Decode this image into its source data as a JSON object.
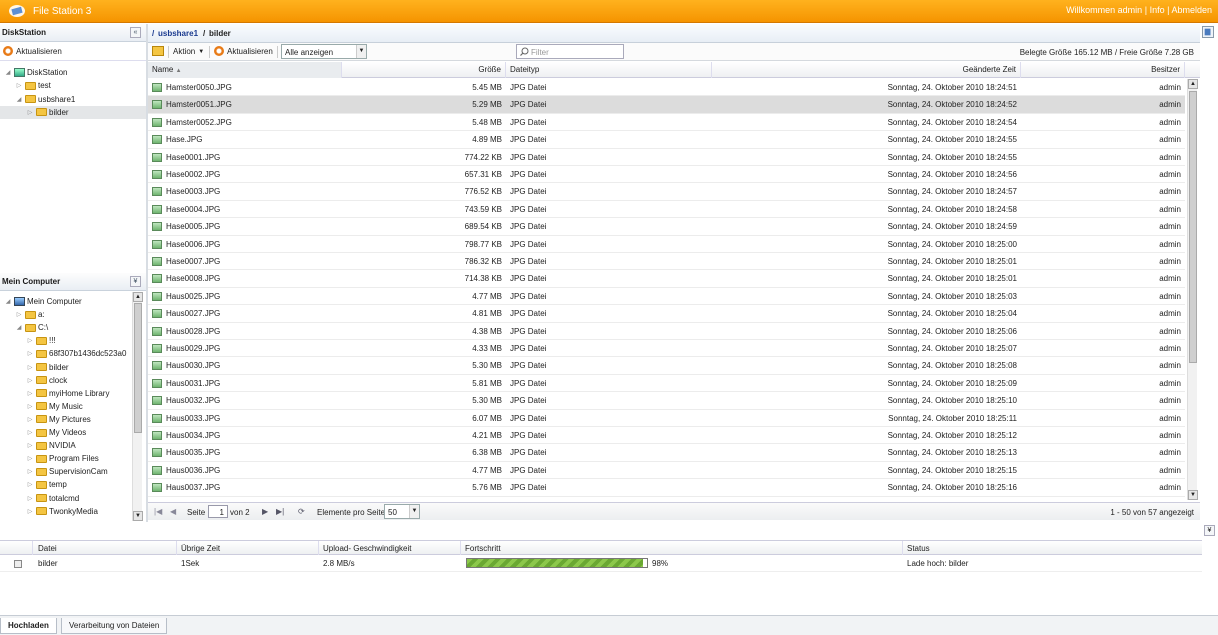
{
  "titlebar": {
    "app_title": "File Station 3",
    "welcome": "Willkommen admin",
    "info": "Info",
    "logout": "Abmelden",
    "sep": "|"
  },
  "diskstation": {
    "title": "DiskStation",
    "refresh": "Aktualisieren",
    "tree": [
      {
        "label": "DiskStation",
        "type": "drive",
        "indent": 0,
        "tri": "◢"
      },
      {
        "label": "test",
        "type": "folder",
        "indent": 1,
        "tri": "▷"
      },
      {
        "label": "usbshare1",
        "type": "folder",
        "indent": 1,
        "tri": "◢"
      },
      {
        "label": "bilder",
        "type": "folder",
        "indent": 2,
        "tri": "▷",
        "selected": true
      }
    ]
  },
  "mycomputer": {
    "title": "Mein Computer",
    "tree": [
      {
        "label": "Mein Computer",
        "type": "pc",
        "indent": 0,
        "tri": "◢"
      },
      {
        "label": "a:",
        "type": "folder",
        "indent": 1,
        "tri": "▷"
      },
      {
        "label": "C:\\",
        "type": "folder",
        "indent": 1,
        "tri": "◢"
      },
      {
        "label": "!!!",
        "type": "folder",
        "indent": 2,
        "tri": "▷"
      },
      {
        "label": "68f307b1436dc523a0",
        "type": "folder",
        "indent": 2,
        "tri": "▷"
      },
      {
        "label": "bilder",
        "type": "folder",
        "indent": 2,
        "tri": "▷"
      },
      {
        "label": "clock",
        "type": "folder",
        "indent": 2,
        "tri": "▷"
      },
      {
        "label": "myiHome Library",
        "type": "folder",
        "indent": 2,
        "tri": "▷"
      },
      {
        "label": "My Music",
        "type": "folder",
        "indent": 2,
        "tri": "▷"
      },
      {
        "label": "My Pictures",
        "type": "folder",
        "indent": 2,
        "tri": "▷"
      },
      {
        "label": "My Videos",
        "type": "folder",
        "indent": 2,
        "tri": "▷"
      },
      {
        "label": "NVIDIA",
        "type": "folder",
        "indent": 2,
        "tri": "▷"
      },
      {
        "label": "Program Files",
        "type": "folder",
        "indent": 2,
        "tri": "▷"
      },
      {
        "label": "SupervisionCam",
        "type": "folder",
        "indent": 2,
        "tri": "▷"
      },
      {
        "label": "temp",
        "type": "folder",
        "indent": 2,
        "tri": "▷"
      },
      {
        "label": "totalcmd",
        "type": "folder",
        "indent": 2,
        "tri": "▷"
      },
      {
        "label": "TwonkyMedia",
        "type": "folder",
        "indent": 2,
        "tri": "▷"
      }
    ]
  },
  "path": {
    "root": "/",
    "share": "usbshare1",
    "sep": "/",
    "folder": "bilder"
  },
  "toolbar": {
    "action": "Aktion",
    "refresh": "Aktualisieren",
    "view_select": "Alle anzeigen",
    "filter_placeholder": "Filter",
    "size_info": "Belegte Größe 165.12 MB / Freie Größe 7.28 GB"
  },
  "columns": {
    "name": "Name",
    "size": "Größe",
    "type": "Dateityp",
    "modified": "Geänderte Zeit",
    "owner": "Besitzer"
  },
  "files": [
    {
      "name": "Hamster0050.JPG",
      "size": "5.45 MB",
      "type": "JPG Datei",
      "modified": "Sonntag, 24. Oktober 2010 18:24:51",
      "owner": "admin"
    },
    {
      "name": "Hamster0051.JPG",
      "size": "5.29 MB",
      "type": "JPG Datei",
      "modified": "Sonntag, 24. Oktober 2010 18:24:52",
      "owner": "admin",
      "selected": true
    },
    {
      "name": "Hamster0052.JPG",
      "size": "5.48 MB",
      "type": "JPG Datei",
      "modified": "Sonntag, 24. Oktober 2010 18:24:54",
      "owner": "admin"
    },
    {
      "name": "Hase.JPG",
      "size": "4.89 MB",
      "type": "JPG Datei",
      "modified": "Sonntag, 24. Oktober 2010 18:24:55",
      "owner": "admin"
    },
    {
      "name": "Hase0001.JPG",
      "size": "774.22 KB",
      "type": "JPG Datei",
      "modified": "Sonntag, 24. Oktober 2010 18:24:55",
      "owner": "admin"
    },
    {
      "name": "Hase0002.JPG",
      "size": "657.31 KB",
      "type": "JPG Datei",
      "modified": "Sonntag, 24. Oktober 2010 18:24:56",
      "owner": "admin"
    },
    {
      "name": "Hase0003.JPG",
      "size": "776.52 KB",
      "type": "JPG Datei",
      "modified": "Sonntag, 24. Oktober 2010 18:24:57",
      "owner": "admin"
    },
    {
      "name": "Hase0004.JPG",
      "size": "743.59 KB",
      "type": "JPG Datei",
      "modified": "Sonntag, 24. Oktober 2010 18:24:58",
      "owner": "admin"
    },
    {
      "name": "Hase0005.JPG",
      "size": "689.54 KB",
      "type": "JPG Datei",
      "modified": "Sonntag, 24. Oktober 2010 18:24:59",
      "owner": "admin"
    },
    {
      "name": "Hase0006.JPG",
      "size": "798.77 KB",
      "type": "JPG Datei",
      "modified": "Sonntag, 24. Oktober 2010 18:25:00",
      "owner": "admin"
    },
    {
      "name": "Hase0007.JPG",
      "size": "786.32 KB",
      "type": "JPG Datei",
      "modified": "Sonntag, 24. Oktober 2010 18:25:01",
      "owner": "admin"
    },
    {
      "name": "Hase0008.JPG",
      "size": "714.38 KB",
      "type": "JPG Datei",
      "modified": "Sonntag, 24. Oktober 2010 18:25:01",
      "owner": "admin"
    },
    {
      "name": "Haus0025.JPG",
      "size": "4.77 MB",
      "type": "JPG Datei",
      "modified": "Sonntag, 24. Oktober 2010 18:25:03",
      "owner": "admin"
    },
    {
      "name": "Haus0027.JPG",
      "size": "4.81 MB",
      "type": "JPG Datei",
      "modified": "Sonntag, 24. Oktober 2010 18:25:04",
      "owner": "admin"
    },
    {
      "name": "Haus0028.JPG",
      "size": "4.38 MB",
      "type": "JPG Datei",
      "modified": "Sonntag, 24. Oktober 2010 18:25:06",
      "owner": "admin"
    },
    {
      "name": "Haus0029.JPG",
      "size": "4.33 MB",
      "type": "JPG Datei",
      "modified": "Sonntag, 24. Oktober 2010 18:25:07",
      "owner": "admin"
    },
    {
      "name": "Haus0030.JPG",
      "size": "5.30 MB",
      "type": "JPG Datei",
      "modified": "Sonntag, 24. Oktober 2010 18:25:08",
      "owner": "admin"
    },
    {
      "name": "Haus0031.JPG",
      "size": "5.81 MB",
      "type": "JPG Datei",
      "modified": "Sonntag, 24. Oktober 2010 18:25:09",
      "owner": "admin"
    },
    {
      "name": "Haus0032.JPG",
      "size": "5.30 MB",
      "type": "JPG Datei",
      "modified": "Sonntag, 24. Oktober 2010 18:25:10",
      "owner": "admin"
    },
    {
      "name": "Haus0033.JPG",
      "size": "6.07 MB",
      "type": "JPG Datei",
      "modified": "Sonntag, 24. Oktober 2010 18:25:11",
      "owner": "admin"
    },
    {
      "name": "Haus0034.JPG",
      "size": "4.21 MB",
      "type": "JPG Datei",
      "modified": "Sonntag, 24. Oktober 2010 18:25:12",
      "owner": "admin"
    },
    {
      "name": "Haus0035.JPG",
      "size": "6.38 MB",
      "type": "JPG Datei",
      "modified": "Sonntag, 24. Oktober 2010 18:25:13",
      "owner": "admin"
    },
    {
      "name": "Haus0036.JPG",
      "size": "4.77 MB",
      "type": "JPG Datei",
      "modified": "Sonntag, 24. Oktober 2010 18:25:15",
      "owner": "admin"
    },
    {
      "name": "Haus0037.JPG",
      "size": "5.76 MB",
      "type": "JPG Datei",
      "modified": "Sonntag, 24. Oktober 2010 18:25:16",
      "owner": "admin"
    }
  ],
  "pager": {
    "page_label": "Seite",
    "page_value": "1",
    "of_label": "von 2",
    "per_page_label": "Elemente pro Seite",
    "per_page_value": "50",
    "range_info": "1 - 50 von 57 angezeigt"
  },
  "upload": {
    "columns": {
      "file": "Datei",
      "remaining": "Übrige Zeit",
      "speed": "Upload- Geschwindigkeit",
      "progress": "Fortschritt",
      "status": "Status"
    },
    "row": {
      "file": "bilder",
      "remaining": "1Sek",
      "speed": "2.8 MB/s",
      "progress": 0.98,
      "progress_text": "98%",
      "status": "Lade hoch: bilder"
    }
  },
  "bottom_tabs": [
    {
      "label": "Hochladen",
      "active": true
    },
    {
      "label": "Verarbeitung von Dateien",
      "active": false
    }
  ],
  "colors": {
    "titlebar": "#f59400",
    "link": "#1a3a8f",
    "progress_fill": "#8cc84b"
  }
}
